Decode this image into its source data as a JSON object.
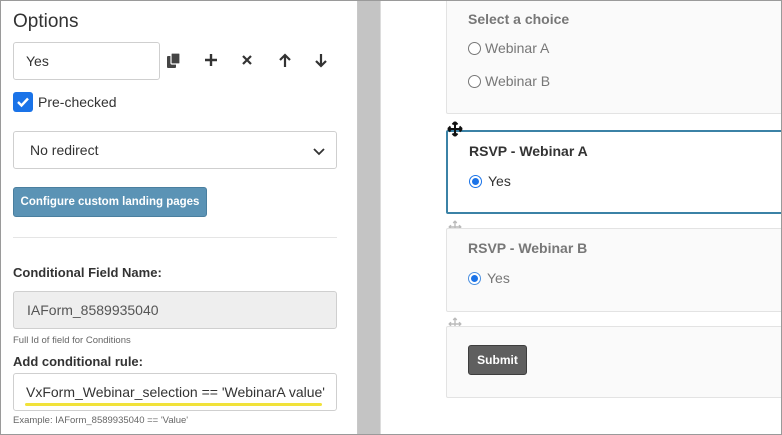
{
  "options_panel": {
    "title": "Options",
    "option_value": "Yes",
    "toolbar": {
      "copy_icon": "copy-icon",
      "add_icon": "plus-icon",
      "remove_icon": "close-icon",
      "up_icon": "arrow-up-icon",
      "down_icon": "arrow-down-icon"
    },
    "prechecked": {
      "label": "Pre-checked",
      "checked": true
    },
    "redirect_select": {
      "value": "No redirect"
    },
    "landing_button": "Configure custom landing pages",
    "conditional_field": {
      "label": "Conditional Field Name:",
      "value": "IAForm_8589935040",
      "help": "Full Id of field for Conditions"
    },
    "conditional_rule": {
      "label": "Add conditional rule:",
      "value": "VxForm_Webinar_selection == 'WebinarA value'",
      "example": "Example: IAForm_8589935040 == 'Value'"
    },
    "accent_color": "#5b93b5",
    "highlight_color": "#f1e23a"
  },
  "form_preview": {
    "choice_card": {
      "title": "Select a choice",
      "options": [
        "Webinar A",
        "Webinar B"
      ]
    },
    "rsvp_a": {
      "title": "RSVP - Webinar A",
      "option": "Yes",
      "selected": true
    },
    "rsvp_b": {
      "title": "RSVP - Webinar B",
      "option": "Yes",
      "selected": true
    },
    "submit_label": "Submit",
    "active_border_color": "#3b82a6"
  }
}
